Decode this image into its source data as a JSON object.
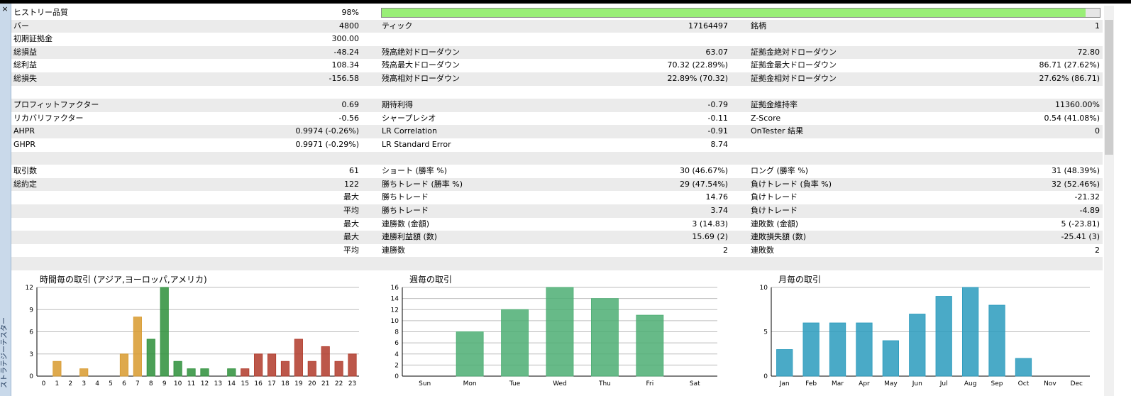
{
  "side_tab_label": "ストラテジーテスター",
  "close_symbol": "×",
  "report": {
    "history_quality": {
      "label": "ヒストリー品質",
      "value": "98%",
      "fraction": 0.98
    },
    "rows": [
      {
        "l1": "バー",
        "v1": "4800",
        "l2": "ティック",
        "v2": "17164497",
        "l3": "銘柄",
        "v3": "1"
      },
      {
        "l1": "初期証拠金",
        "v1": "300.00",
        "l2": "",
        "v2": "",
        "l3": "",
        "v3": ""
      },
      {
        "l1": "総損益",
        "v1": "-48.24",
        "l2": "残高絶対ドローダウン",
        "v2": "63.07",
        "l3": "証拠金絶対ドローダウン",
        "v3": "72.80"
      },
      {
        "l1": "総利益",
        "v1": "108.34",
        "l2": "残高最大ドローダウン",
        "v2": "70.32 (22.89%)",
        "l3": "証拠金最大ドローダウン",
        "v3": "86.71 (27.62%)"
      },
      {
        "l1": "総損失",
        "v1": "-156.58",
        "l2": "残高相対ドローダウン",
        "v2": "22.89% (70.32)",
        "l3": "証拠金相対ドローダウン",
        "v3": "27.62% (86.71)"
      },
      {
        "l1": "",
        "v1": "",
        "l2": "",
        "v2": "",
        "l3": "",
        "v3": ""
      },
      {
        "l1": "プロフィットファクター",
        "v1": "0.69",
        "l2": "期待利得",
        "v2": "-0.79",
        "l3": "証拠金維持率",
        "v3": "11360.00%"
      },
      {
        "l1": "リカバリファクター",
        "v1": "-0.56",
        "l2": "シャープレシオ",
        "v2": "-0.11",
        "l3": "Z-Score",
        "v3": "0.54 (41.08%)"
      },
      {
        "l1": "AHPR",
        "v1": "0.9974 (-0.26%)",
        "l2": "LR Correlation",
        "v2": "-0.91",
        "l3": "OnTester 結果",
        "v3": "0"
      },
      {
        "l1": "GHPR",
        "v1": "0.9971 (-0.29%)",
        "l2": "LR Standard Error",
        "v2": "8.74",
        "l3": "",
        "v3": ""
      },
      {
        "l1": "",
        "v1": "",
        "l2": "",
        "v2": "",
        "l3": "",
        "v3": ""
      },
      {
        "l1": "取引数",
        "v1": "61",
        "l2": "ショート (勝率 %)",
        "v2": "30 (46.67%)",
        "l3": "ロング (勝率 %)",
        "v3": "31 (48.39%)"
      },
      {
        "l1": "総約定",
        "v1": "122",
        "l2": "勝ちトレード (勝率 %)",
        "v2": "29 (47.54%)",
        "l3": "負けトレード (負率 %)",
        "v3": "32 (52.46%)"
      },
      {
        "l1": "",
        "v1": "最大",
        "l2": "勝ちトレード",
        "v2": "14.76",
        "l3": "負けトレード",
        "v3": "-21.32"
      },
      {
        "l1": "",
        "v1": "平均",
        "l2": "勝ちトレード",
        "v2": "3.74",
        "l3": "負けトレード",
        "v3": "-4.89"
      },
      {
        "l1": "",
        "v1": "最大",
        "l2": "連勝数 (金額)",
        "v2": "3 (14.83)",
        "l3": "連敗数 (金額)",
        "v3": "5 (-23.81)"
      },
      {
        "l1": "",
        "v1": "最大",
        "l2": "連勝利益額 (数)",
        "v2": "15.69 (2)",
        "l3": "連敗損失額 (数)",
        "v3": "-25.41 (3)"
      },
      {
        "l1": "",
        "v1": "平均",
        "l2": "連勝数",
        "v2": "2",
        "l3": "連敗数",
        "v3": "2"
      },
      {
        "l1": "",
        "v1": "",
        "l2": "",
        "v2": "",
        "l3": "",
        "v3": ""
      }
    ]
  },
  "colors": {
    "hour_asia": "#d89a2e",
    "hour_europe": "#2d8f3a",
    "hour_america": "#b03a2a",
    "weekday": "#4cae73",
    "month": "#2a9bbd",
    "quality_fill": "#99ee77"
  },
  "chart_data": [
    {
      "type": "bar",
      "title": "時間毎の取引 (アジア,ヨーロッパ,アメリカ)",
      "categories": [
        "0",
        "1",
        "2",
        "3",
        "4",
        "5",
        "6",
        "7",
        "8",
        "9",
        "10",
        "11",
        "12",
        "13",
        "14",
        "15",
        "16",
        "17",
        "18",
        "19",
        "20",
        "21",
        "22",
        "23"
      ],
      "values": [
        0,
        2,
        0,
        1,
        0,
        0,
        3,
        8,
        5,
        12,
        2,
        1,
        1,
        0,
        1,
        1,
        3,
        3,
        2,
        5,
        2,
        4,
        2,
        3
      ],
      "sessions": [
        "asia",
        "asia",
        "asia",
        "asia",
        "asia",
        "asia",
        "asia",
        "asia",
        "europe",
        "europe",
        "europe",
        "europe",
        "europe",
        "europe",
        "europe",
        "america",
        "america",
        "america",
        "america",
        "america",
        "america",
        "america",
        "america",
        "america"
      ],
      "ylim": [
        0,
        12
      ],
      "yticks": [
        0,
        3,
        6,
        9,
        12
      ],
      "grid": true
    },
    {
      "type": "bar",
      "title": "週毎の取引",
      "categories": [
        "Sun",
        "Mon",
        "Tue",
        "Wed",
        "Thu",
        "Fri",
        "Sat"
      ],
      "values": [
        0,
        8,
        12,
        16,
        14,
        11,
        0
      ],
      "ylim": [
        0,
        16
      ],
      "yticks": [
        0,
        2,
        4,
        6,
        8,
        10,
        12,
        14,
        16
      ],
      "grid": true
    },
    {
      "type": "bar",
      "title": "月毎の取引",
      "categories": [
        "Jan",
        "Feb",
        "Mar",
        "Apr",
        "May",
        "Jun",
        "Jul",
        "Aug",
        "Sep",
        "Oct",
        "Nov",
        "Dec"
      ],
      "values": [
        3,
        6,
        6,
        6,
        4,
        7,
        9,
        10,
        8,
        2,
        0,
        0
      ],
      "ylim": [
        0,
        10
      ],
      "yticks": [
        0,
        5,
        10
      ],
      "grid": true
    }
  ]
}
